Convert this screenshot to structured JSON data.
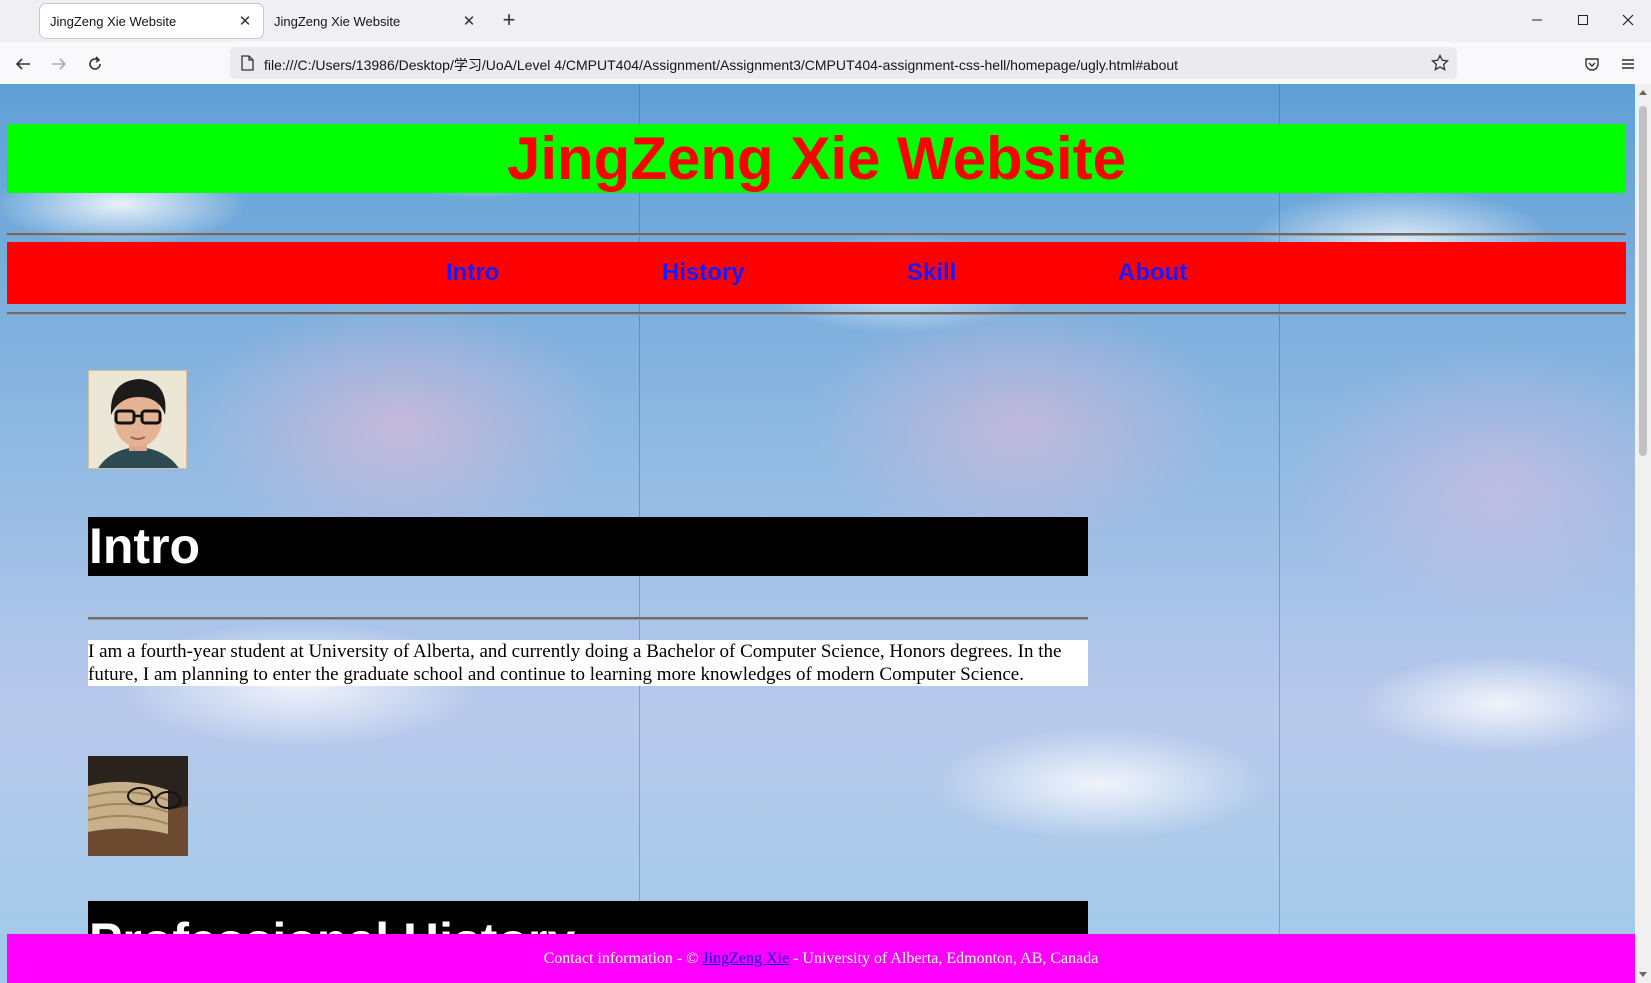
{
  "browser": {
    "tabs": [
      {
        "title": "JingZeng Xie Website",
        "active": true
      },
      {
        "title": "JingZeng Xie Website",
        "active": false
      }
    ],
    "new_tab_icon": "plus-icon",
    "url": "file:///C:/Users/13986/Desktop/学习/UoA/Level 4/CMPUT404/Assignment/Assignment3/CMPUT404-assignment-css-hell/homepage/ugly.html#about"
  },
  "site": {
    "title": "JingZeng Xie Website",
    "nav": [
      "Intro",
      "History",
      "Skill",
      "About"
    ],
    "intro_heading": "Intro",
    "intro_text": "I am a fourth-year student at University of Alberta, and currently doing a Bachelor of Computer Science, Honors degrees. In the future, I am planning to enter the graduate school and continue to learning more knowledges of modern Computer Science.",
    "history_heading": "Professional History",
    "footer": {
      "prefix": "Contact information - © ",
      "link": "JingZeng Xie",
      "suffix": " - University of Alberta, Edmonton, AB, Canada"
    }
  },
  "colors": {
    "title_bg": "#00ff00",
    "title_fg": "#ff0000",
    "menu_bg": "#ff0000",
    "menu_link": "#1a1aff",
    "heading_bg": "#000000",
    "footer_bg": "#ff00ff"
  }
}
